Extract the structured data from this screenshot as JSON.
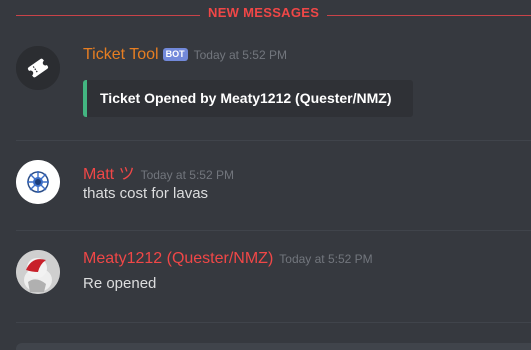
{
  "divider": {
    "label": "NEW MESSAGES"
  },
  "messages": [
    {
      "author": "Ticket Tool",
      "author_color": "#e67e22",
      "bot_tag": "BOT",
      "timestamp": "Today at 5:52 PM",
      "avatar_icon": "ticket-icon",
      "embed": {
        "title": "Ticket Opened by Meaty1212 (Quester/NMZ)",
        "accent": "#43b581"
      }
    },
    {
      "author": "Matt ツ",
      "author_color": "#f04747",
      "timestamp": "Today at 5:52 PM",
      "avatar_icon": "badge-icon",
      "text": "thats cost for lavas"
    },
    {
      "author": "Meaty1212 (Quester/NMZ)",
      "author_color": "#f04747",
      "timestamp": "Today at 5:52 PM",
      "avatar_icon": "character-icon",
      "text": "Re opened"
    }
  ]
}
